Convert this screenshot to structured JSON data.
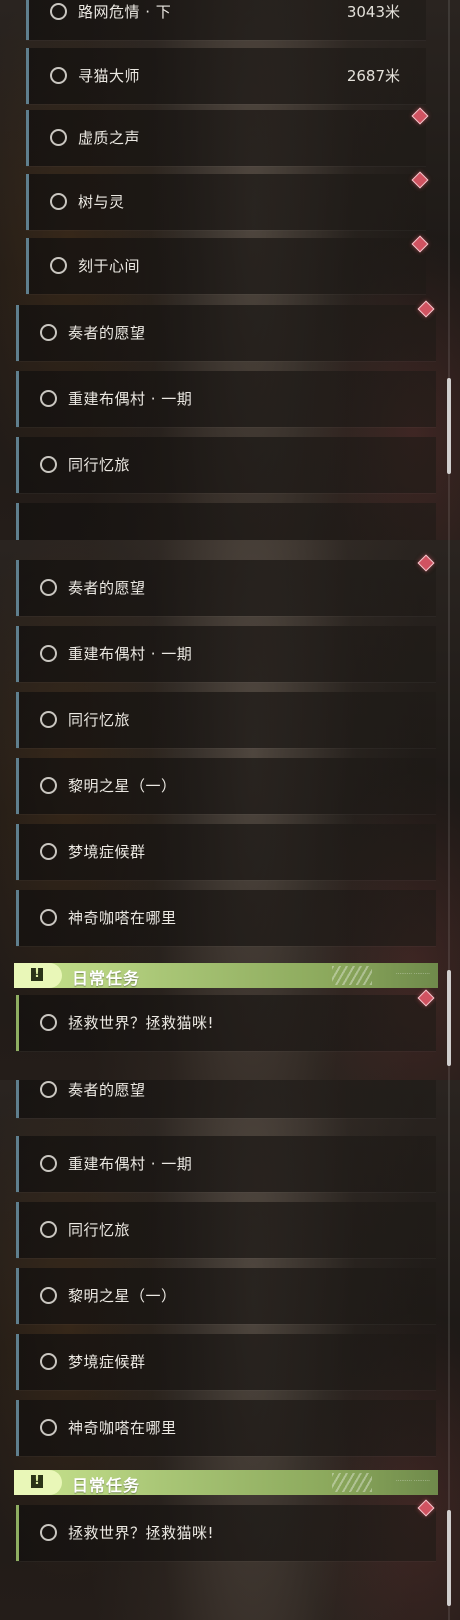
{
  "panels": [
    {
      "quests": [
        {
          "title": "路网危情 · 下",
          "distance": "3043米"
        },
        {
          "title": "寻猫大师",
          "distance": "2687米"
        },
        {
          "title": "虚质之声"
        },
        {
          "title": "树与灵"
        },
        {
          "title": "刻于心间"
        },
        {
          "title": "奏者的愿望"
        },
        {
          "title": "重建布偶村 · 一期"
        },
        {
          "title": "同行忆旅"
        }
      ]
    },
    {
      "quests": [
        {
          "title": "奏者的愿望"
        },
        {
          "title": "重建布偶村 · 一期"
        },
        {
          "title": "同行忆旅"
        },
        {
          "title": "黎明之星（一）"
        },
        {
          "title": "梦境症候群"
        },
        {
          "title": "神奇咖嗒在哪里"
        }
      ],
      "daily_header": {
        "icon": "exclamation-icon",
        "icon_glyph": "!",
        "title": "日常任务",
        "tagline": "·········  ·········"
      },
      "daily_quests": [
        {
          "title": "拯救世界？拯救猫咪!"
        }
      ]
    },
    {
      "quests": [
        {
          "title": "奏者的愿望"
        },
        {
          "title": "重建布偶村 · 一期"
        },
        {
          "title": "同行忆旅"
        },
        {
          "title": "黎明之星（一）"
        },
        {
          "title": "梦境症候群"
        },
        {
          "title": "神奇咖嗒在哪里"
        }
      ],
      "daily_header": {
        "icon": "exclamation-icon",
        "icon_glyph": "!",
        "title": "日常任务",
        "tagline": "·········  ·········"
      },
      "daily_quests": [
        {
          "title": "拯救世界？拯救猫咪!"
        }
      ]
    }
  ],
  "colors": {
    "quest_accent": "#5f7f8e",
    "daily_accent": "#8fae62",
    "header_green": "#b5d27f",
    "marker_red": "#d05361"
  }
}
